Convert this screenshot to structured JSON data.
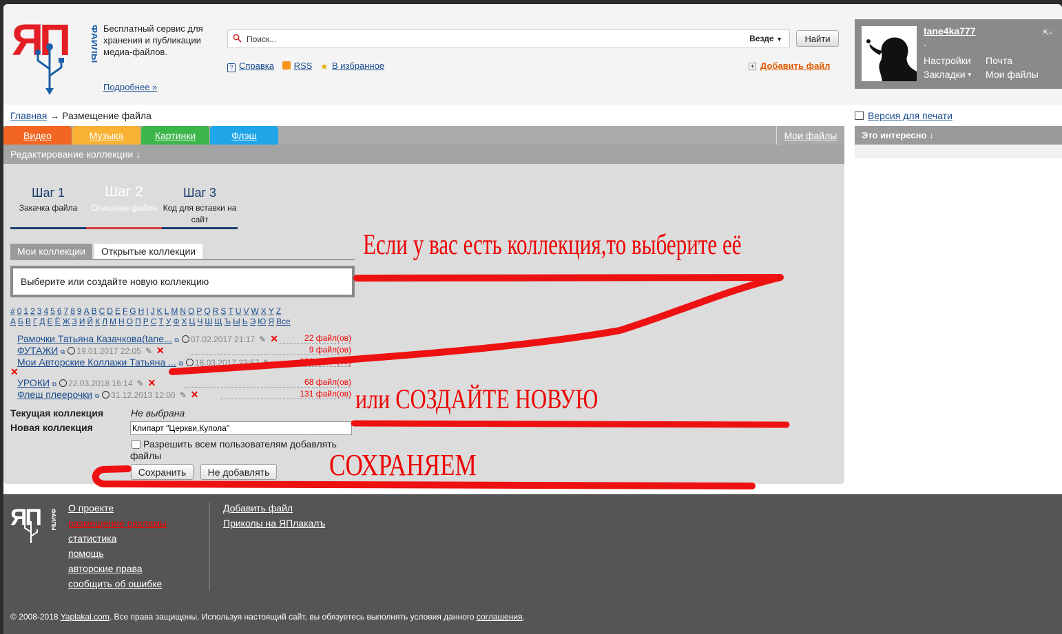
{
  "header": {
    "tagline": "Бесплатный сервис для хранения и публикации медиа-файлов.",
    "more_link": "Подробнее »",
    "search_placeholder": "Поиск...",
    "search_scope": "Везде",
    "find_button": "Найти",
    "help": "Справка",
    "rss": "RSS",
    "favorites": "В избранное",
    "add_file": "Добавить файл"
  },
  "user": {
    "username": "tane4ka777",
    "dash": "-",
    "settings": "Настройки",
    "mail": "Почта",
    "bookmarks": "Закладки",
    "my_files": "Мои файлы"
  },
  "breadcrumb": {
    "home": "Главная",
    "arrow": "→",
    "current": "Размещение файла"
  },
  "print_version": "Версия для печати",
  "category_tabs": [
    {
      "label": "Видео",
      "color": "#f26522"
    },
    {
      "label": "Музыка",
      "color": "#f9b233"
    },
    {
      "label": "Картинки",
      "color": "#3cb54a"
    },
    {
      "label": "Флэш",
      "color": "#1fa5e8"
    }
  ],
  "my_files_tab": "Мои файлы",
  "interesting": "Это интересно ↓",
  "main": {
    "heading": "Редактирование коллекции ↓",
    "steps": [
      {
        "title": "Шаг 1",
        "desc": "Закачка файла"
      },
      {
        "title": "Шаг 2",
        "desc": "Описание файла"
      },
      {
        "title": "Шаг 3",
        "desc": "Код для вставки на сайт"
      }
    ],
    "collection_tabs": [
      "Мои коллекции",
      "Открытые коллекции"
    ],
    "select_prompt": "Выберите или создайте новую коллекцию",
    "alphabet_latin": [
      "#",
      "0",
      "1",
      "2",
      "3",
      "4",
      "5",
      "6",
      "7",
      "8",
      "9",
      "A",
      "B",
      "C",
      "D",
      "E",
      "F",
      "G",
      "H",
      "I",
      "J",
      "K",
      "L",
      "M",
      "N",
      "O",
      "P",
      "Q",
      "R",
      "S",
      "T",
      "U",
      "V",
      "W",
      "X",
      "Y",
      "Z"
    ],
    "alphabet_cyr": [
      "А",
      "Б",
      "В",
      "Г",
      "Д",
      "Е",
      "Ё",
      "Ж",
      "З",
      "И",
      "Й",
      "К",
      "Л",
      "М",
      "Н",
      "О",
      "П",
      "Р",
      "С",
      "Т",
      "У",
      "Ф",
      "Х",
      "Ц",
      "Ч",
      "Ш",
      "Щ",
      "Ъ",
      "Ы",
      "Ь",
      "Э",
      "Ю",
      "Я",
      "Все"
    ],
    "collections": [
      {
        "name": "Рамочки Татьяна Казачкова(tane...",
        "date": "07.02.2017 21:17",
        "count": "22 файл(ов)"
      },
      {
        "name": "ФУТАЖИ",
        "date": "19.01.2017 22:05",
        "count": "9 файл(ов)"
      },
      {
        "name": "Мои Авторские Коллажи Татьяна ...",
        "date": "18.03.2017 22:57",
        "count": "100 файл(ов)"
      },
      {
        "name": "УРОКИ",
        "date": "22.03.2018 16:14",
        "count": "68 файл(ов)"
      },
      {
        "name": "Флеш плеерочки",
        "date": "31.12.2013 12:00",
        "count": "131 файл(ов)"
      }
    ],
    "current_label": "Текущая коллекция",
    "current_value": "Не выбрана",
    "new_label": "Новая коллекция",
    "new_value": "Клипарт \"Церкви,Купола\"",
    "allow_all": "Разрешить всем пользователям добавлять файлы",
    "save_button": "Сохранить",
    "skip_button": "Не добавлять"
  },
  "annotations": {
    "choose": "Если у вас есть коллекция,то выберите её",
    "create": "или СОЗДАЙТЕ НОВУЮ",
    "save": "СОХРАНЯЕМ"
  },
  "footer": {
    "col1": [
      "О проекте",
      "размещение рекламы",
      "статистика",
      "помощь",
      "авторские права",
      "сообщить об ошибке"
    ],
    "col2": [
      "Добавить файл",
      "Приколы на ЯПлакалъ"
    ],
    "copyright_prefix": "© 2008-2018",
    "copyright_site": "Yaplakal.com",
    "copyright_text": ". Все права защищены. Используя настоящий сайт, вы обязуетесь выполнять условия данного",
    "copyright_link": "соглашения",
    "copyright_end": "."
  },
  "colors": {
    "accent_link": "#1a4d8f",
    "add_file": "#e05a00",
    "annotation": "#ee0000",
    "footer_bg": "#555555"
  }
}
